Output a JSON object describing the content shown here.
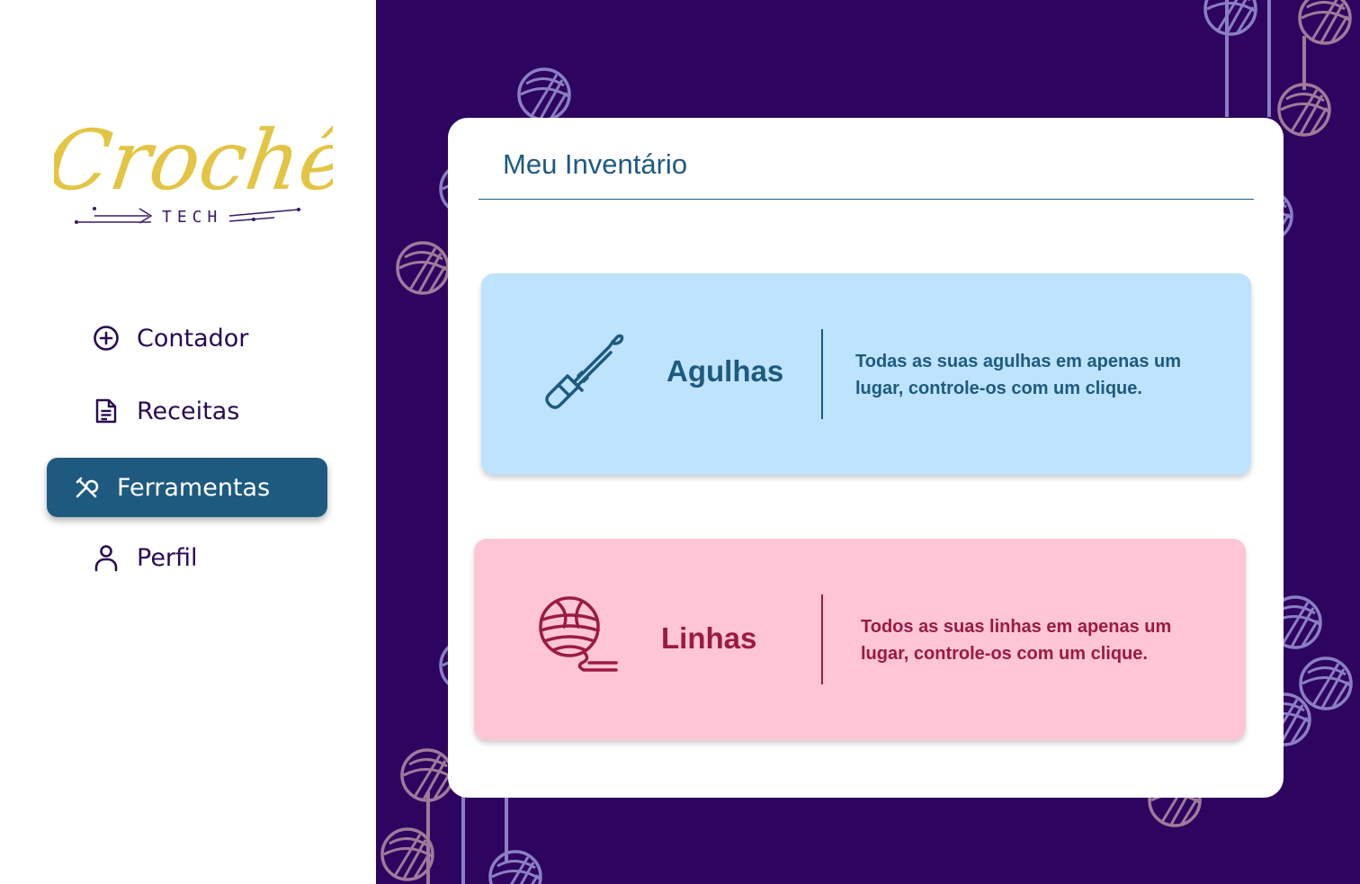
{
  "brand": {
    "name": "Crochê",
    "sub": "TECH",
    "color": "#e3c545"
  },
  "nav": {
    "items": [
      {
        "label": "Contador",
        "icon": "plus-circle-icon",
        "active": false
      },
      {
        "label": "Receitas",
        "icon": "document-icon",
        "active": false
      },
      {
        "label": "Ferramentas",
        "icon": "tools-icon",
        "active": true
      },
      {
        "label": "Perfil",
        "icon": "user-icon",
        "active": false
      }
    ],
    "active_color": "#1e5a80"
  },
  "inventory": {
    "title": "Meu Inventário",
    "boxes": [
      {
        "label": "Agulhas",
        "icon": "crochet-hook-icon",
        "description": "Todas as suas agulhas em apenas um lugar, controle-os com um clique.",
        "bg": "#bee3fd",
        "fg": "#1e5a80"
      },
      {
        "label": "Linhas",
        "icon": "yarn-ball-icon",
        "description": "Todos as suas linhas em apenas um lugar, controle-os com um clique.",
        "bg": "#fec6d5",
        "fg": "#9b1a45"
      }
    ]
  },
  "theme": {
    "background": "#2d0560"
  }
}
